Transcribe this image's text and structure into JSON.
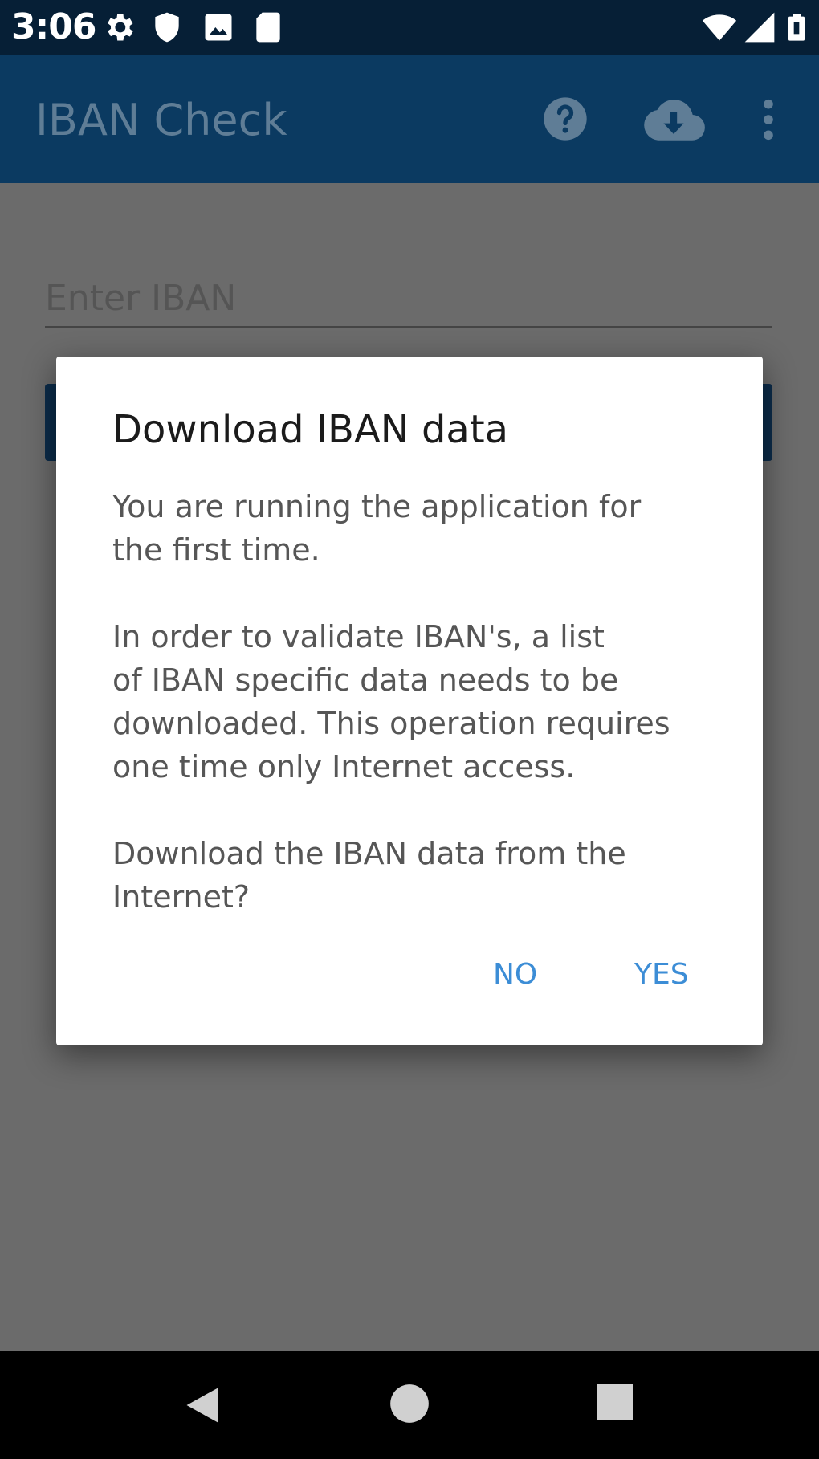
{
  "status_bar": {
    "time": "3:06",
    "icons": [
      "settings-icon",
      "shield-icon",
      "photo-icon",
      "sd-card-icon",
      "wifi-icon",
      "signal-icon",
      "battery-icon"
    ]
  },
  "app_bar": {
    "title": "IBAN Check",
    "icons": [
      "help-icon",
      "cloud-download-icon",
      "more-vert-icon"
    ],
    "color": "#0b3a61"
  },
  "main": {
    "iban_input": {
      "value": "",
      "placeholder": "Enter IBAN"
    }
  },
  "dialog": {
    "title": "Download IBAN data",
    "message": "You are running the application for\nthe first time.\n\n In order to validate IBAN's, a list\nof IBAN specific data needs to be\ndownloaded. This operation requires\none time only Internet access.\n\n Download the IBAN data from the\nInternet?",
    "no_label": "NO",
    "yes_label": "YES",
    "accent": "#3c8dd6"
  },
  "nav_bar": {
    "icons": [
      "back-icon",
      "home-icon",
      "recents-icon"
    ]
  }
}
